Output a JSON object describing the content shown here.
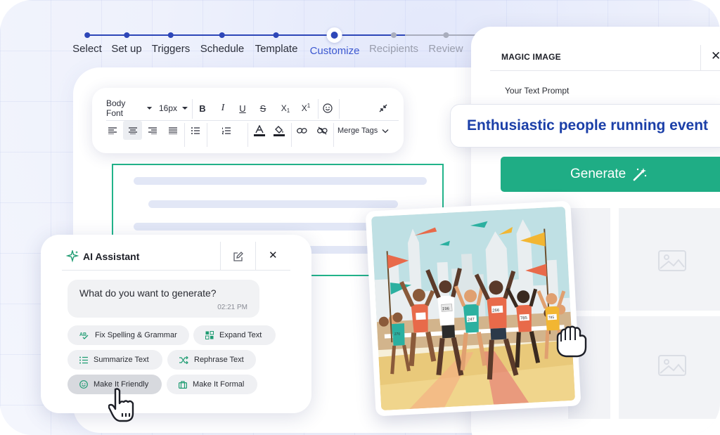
{
  "stepper": {
    "steps": [
      {
        "label": "Select",
        "state": "done"
      },
      {
        "label": "Set up",
        "state": "done"
      },
      {
        "label": "Triggers",
        "state": "done"
      },
      {
        "label": "Schedule",
        "state": "done"
      },
      {
        "label": "Template",
        "state": "done"
      },
      {
        "label": "Customize",
        "state": "current"
      },
      {
        "label": "Recipients",
        "state": "todo"
      },
      {
        "label": "Review",
        "state": "todo"
      }
    ]
  },
  "toolbar": {
    "font_family": "Body Font",
    "font_size": "16px",
    "merge_tags": "Merge Tags"
  },
  "ai_assistant": {
    "title": "AI Assistant",
    "question": "What do you want to generate?",
    "time": "02:21 PM",
    "chips": [
      {
        "label": "Fix Spelling & Grammar",
        "icon": "spellcheck-icon"
      },
      {
        "label": "Expand Text",
        "icon": "expand-icon"
      },
      {
        "label": "Summarize Text",
        "icon": "list-icon"
      },
      {
        "label": "Rephrase Text",
        "icon": "shuffle-icon"
      },
      {
        "label": "Make It Friendly",
        "icon": "smile-icon"
      },
      {
        "label": "Make It Formal",
        "icon": "briefcase-icon"
      }
    ]
  },
  "magic_image": {
    "title": "MAGIC IMAGE",
    "prompt_label": "Your Text Prompt",
    "prompt_value": "Enthusiastic people running event",
    "generate_label": "Generate"
  },
  "image": {
    "bibs": [
      "196",
      "266",
      "247",
      "785",
      "785",
      "270"
    ]
  },
  "colors": {
    "primary": "#2d46b8",
    "accent_green": "#1fad85",
    "prompt_text": "#1b3fa8"
  }
}
